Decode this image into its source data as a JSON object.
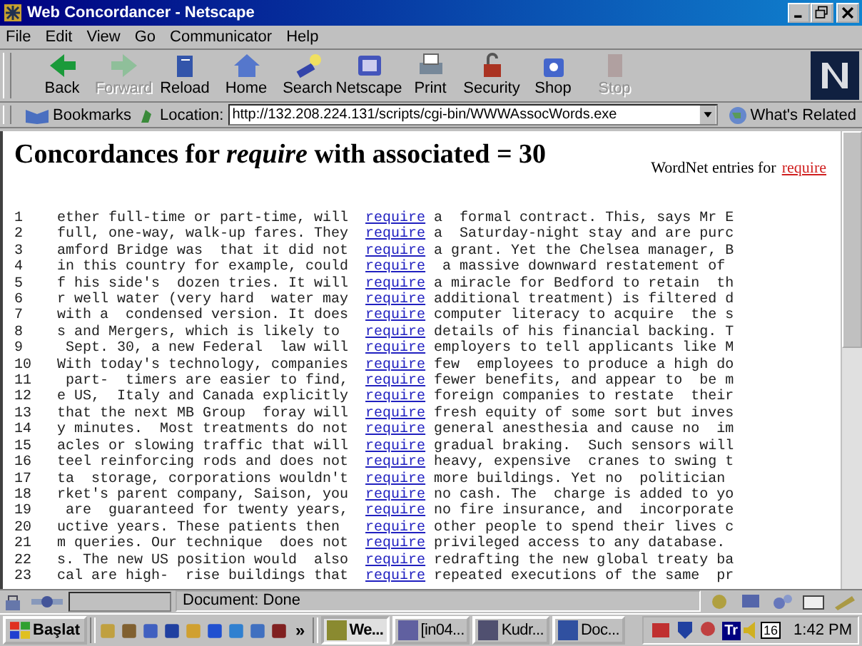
{
  "window": {
    "title": "Web Concordancer - Netscape"
  },
  "menu": [
    "File",
    "Edit",
    "View",
    "Go",
    "Communicator",
    "Help"
  ],
  "toolbar": [
    {
      "label": "Back",
      "disabled": false
    },
    {
      "label": "Forward",
      "disabled": true
    },
    {
      "label": "Reload",
      "disabled": false
    },
    {
      "label": "Home",
      "disabled": false
    },
    {
      "label": "Search",
      "disabled": false
    },
    {
      "label": "Netscape",
      "disabled": false
    },
    {
      "label": "Print",
      "disabled": false
    },
    {
      "label": "Security",
      "disabled": false
    },
    {
      "label": "Shop",
      "disabled": false
    },
    {
      "label": "Stop",
      "disabled": true
    }
  ],
  "location_bar": {
    "bookmarks": "Bookmarks",
    "location_label": "Location:",
    "url": "http://132.208.224.131/scripts/cgi-bin/WWWAssocWords.exe",
    "whats_related": "What's Related"
  },
  "page": {
    "heading": "Concordances for *require* with associated = 30",
    "wordnet_text": "WordNet entries for",
    "wordnet_link": "require",
    "lines": [
      {
        "number": "1",
        "left": "ether full-time or part-time, will",
        "keyword": "require",
        "right": "a  formal contract. This, says Mr E"
      },
      {
        "number": "2",
        "left": "full, one-way, walk-up fares. They",
        "keyword": "require",
        "right": "a  Saturday-night stay and are purc"
      },
      {
        "number": "3",
        "left": "amford Bridge was  that it did not",
        "keyword": "require",
        "right": "a grant. Yet the Chelsea manager, B"
      },
      {
        "number": "4",
        "left": "in this country for example, could",
        "keyword": "require",
        "right": " a massive downward restatement of"
      },
      {
        "number": "5",
        "left": "f his side's  dozen tries. It will",
        "keyword": "require",
        "right": "a miracle for Bedford to retain  th"
      },
      {
        "number": "6",
        "left": "r well water (very hard  water may",
        "keyword": "require",
        "right": "additional treatment) is filtered d"
      },
      {
        "number": "7",
        "left": "with a  condensed version. It does",
        "keyword": "require",
        "right": "computer literacy to acquire  the s"
      },
      {
        "number": "8",
        "left": "s and Mergers, which is likely to ",
        "keyword": "require",
        "right": "details of his financial backing. T"
      },
      {
        "number": "9",
        "left": " Sept. 30, a new Federal  law will",
        "keyword": "require",
        "right": "employers to tell applicants like M"
      },
      {
        "number": "10",
        "left": "With today's technology, companies",
        "keyword": "require",
        "right": "few  employees to produce a high do"
      },
      {
        "number": "11",
        "left": " part-  timers are easier to find,",
        "keyword": "require",
        "right": "fewer benefits, and appear to  be m"
      },
      {
        "number": "12",
        "left": "e US,  Italy and Canada explicitly",
        "keyword": "require",
        "right": "foreign companies to restate  their"
      },
      {
        "number": "13",
        "left": "that the next MB Group  foray will",
        "keyword": "require",
        "right": "fresh equity of some sort but inves"
      },
      {
        "number": "14",
        "left": "y minutes.  Most treatments do not",
        "keyword": "require",
        "right": "general anesthesia and cause no  im"
      },
      {
        "number": "15",
        "left": "acles or slowing traffic that will",
        "keyword": "require",
        "right": "gradual braking.  Such sensors will"
      },
      {
        "number": "16",
        "left": "teel reinforcing rods and does not",
        "keyword": "require",
        "right": "heavy, expensive  cranes to swing t"
      },
      {
        "number": "17",
        "left": "ta  storage, corporations wouldn't",
        "keyword": "require",
        "right": "more buildings. Yet no  politician"
      },
      {
        "number": "18",
        "left": "rket's parent company, Saison, you",
        "keyword": "require",
        "right": "no cash. The  charge is added to yo"
      },
      {
        "number": "19",
        "left": " are  guaranteed for twenty years,",
        "keyword": "require",
        "right": "no fire insurance, and  incorporate"
      },
      {
        "number": "20",
        "left": "uctive years. These patients then ",
        "keyword": "require",
        "right": "other people to spend their lives c"
      },
      {
        "number": "21",
        "left": "m queries. Our technique  does not",
        "keyword": "require",
        "right": "privileged access to any database."
      },
      {
        "number": "22",
        "left": "s. The new US position would  also",
        "keyword": "require",
        "right": "redrafting the new global treaty ba"
      },
      {
        "number": "23",
        "left": "cal are high-  rise buildings that",
        "keyword": "require",
        "right": "repeated executions of the same  pr"
      }
    ]
  },
  "status_bar": {
    "text": "Document: Done"
  },
  "taskbar": {
    "start": "Başlat",
    "more": "»",
    "tasks": [
      {
        "label": "We...",
        "selected": true
      },
      {
        "label": "[in04...",
        "selected": false
      },
      {
        "label": "Kudr...",
        "selected": false
      },
      {
        "label": "Doc...",
        "selected": false
      }
    ],
    "tray_text": "Tr",
    "calendar": "16",
    "clock": "1:42 PM"
  }
}
